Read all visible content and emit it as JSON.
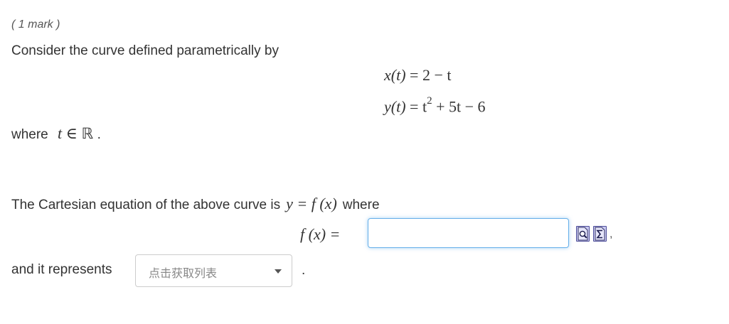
{
  "question": {
    "mark": "( 1 mark )",
    "intro": "Consider the curve defined parametrically by",
    "equations": {
      "x_lhs": "x(t)",
      "x_rhs": "= 2 − t",
      "y_lhs": "y(t)",
      "y_rhs_base": "= t",
      "y_rhs_exp": "2",
      "y_rhs_rest": " + 5t − 6"
    },
    "where_prefix": "where",
    "domain_var": "t",
    "domain_symbol": "∈",
    "domain_set": "ℝ",
    "domain_period": ".",
    "cartesian_text": "The Cartesian equation of the above curve is",
    "cartesian_math": "y = f (x)",
    "cartesian_suffix": "where",
    "f_label": "f (x) =",
    "answer": {
      "value": "",
      "placeholder": ""
    },
    "tools": {
      "preview_icon": "preview-magnifier-icon",
      "syntax_icon": "sigma-syntax-icon",
      "trailing_comma": ","
    },
    "represents_text": "and it represents",
    "select": {
      "selected": "点击获取列表"
    },
    "final_period": "."
  },
  "colors": {
    "input_focus_border": "#66afe9",
    "tool_button_fill": "#c8c8f0",
    "tool_button_border": "#4d4d99",
    "text": "#333333"
  }
}
